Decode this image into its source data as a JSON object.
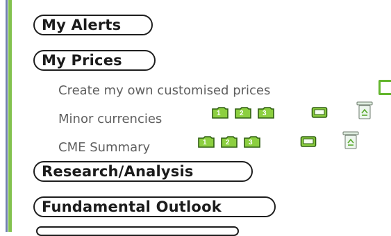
{
  "colors": {
    "rail_blue": "#6f7fae",
    "rail_green": "#83c24f",
    "icon_green": "#63b62d"
  },
  "menu": {
    "alerts": {
      "label": "My Alerts"
    },
    "prices": {
      "label": "My Prices",
      "items": [
        {
          "label": "Create my own customised prices",
          "icons": [
            "create-box-icon"
          ]
        },
        {
          "label": "Minor currencies",
          "icons": [
            "folder-1-icon",
            "folder-2-icon",
            "folder-3-icon",
            "edit-box-icon",
            "recycle-bin-icon"
          ]
        },
        {
          "label": "CME Summary",
          "icons": [
            "folder-1-icon",
            "folder-2-icon",
            "folder-3-icon",
            "edit-box-icon",
            "recycle-bin-icon"
          ]
        }
      ]
    },
    "research": {
      "label": "Research/Analysis"
    },
    "fundamental": {
      "label": "Fundamental Outlook"
    }
  },
  "folder_numbers": [
    "1",
    "2",
    "3"
  ]
}
